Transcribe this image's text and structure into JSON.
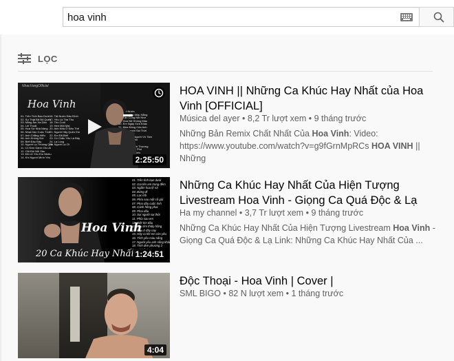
{
  "search": {
    "query": "hoa vinh",
    "keyboard_icon": "keyboard-icon",
    "search_icon": "search-icon"
  },
  "filter": {
    "label": "LỌC",
    "icon": "filter-sliders-icon"
  },
  "results": [
    {
      "title": "HOA VINH || Những Ca Khúc Hay Nhất của Hoa Vinh [OFFICIAL]",
      "channel": "Música del ayer",
      "views": "8,2 Tr lượt xem",
      "age": "9 tháng trước",
      "duration": "2:25:50",
      "desc_pre": "Những Bản Remix Chất Nhất Của ",
      "desc_bold1": "Hoa Vinh",
      "desc_mid": ": Video: https://www.youtube.com/watch?v=g9fGrnMpRCs ",
      "desc_bold2": "HOA VINH",
      "desc_post": " || Những",
      "thumb_text_top": "NhacVangOfficial",
      "thumb_text_script": "Hoa Vinh"
    },
    {
      "title": "Những Ca Khúc Hay Nhất Của Hiện Tượng Livestream Hoa Vinh - Giọng Ca Quá Độc & Lạ",
      "channel": "Ha my channel",
      "views": "3,7 Tr lượt xem",
      "age": "9 tháng trước",
      "duration": "1:24:51",
      "desc_pre": "Những Ca Khúc Hay Nhất Của Hiện Tượng Livestream ",
      "desc_bold1": "Hoa Vinh",
      "desc_mid": " - Giọng Ca Quá Độc & Lạ Link: Những Ca Khúc Hay Nhất Của ...",
      "thumb_text_name": "Hoa Vinh",
      "thumb_text_bottom": "20 Ca Khúc Hay Nhất"
    },
    {
      "title": "Độc Thoại - Hoa Vinh | Cover |",
      "channel": "SML BIGO",
      "views": "82 N lượt xem",
      "age": "1 tháng trước",
      "duration": "4:04"
    }
  ],
  "meta_separator": "•",
  "colors": {
    "text_primary": "#030303",
    "text_secondary": "#606060",
    "background": "#f9f9f9"
  }
}
